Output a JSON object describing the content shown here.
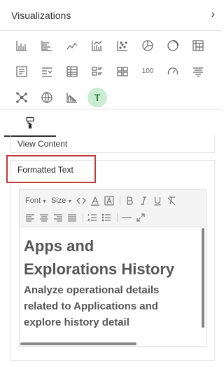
{
  "panel": {
    "title": "Visualizations",
    "collapse_icon": "chevron-right-icon"
  },
  "visualizations": {
    "rows": [
      [
        {
          "name": "column-chart-icon"
        },
        {
          "name": "bar-chart-icon"
        },
        {
          "name": "line-chart-icon"
        },
        {
          "name": "combo-chart-icon"
        },
        {
          "name": "scatter-chart-icon"
        },
        {
          "name": "pie-chart-icon"
        },
        {
          "name": "donut-chart-icon"
        },
        {
          "name": "pivot-table-icon"
        }
      ],
      [
        {
          "name": "form-icon"
        },
        {
          "name": "filter-list-icon"
        },
        {
          "name": "table-icon"
        },
        {
          "name": "list-detail-icon"
        },
        {
          "name": "tiles-icon"
        },
        {
          "name": "kpi-number-icon",
          "label": "100"
        },
        {
          "name": "gauge-icon"
        },
        {
          "name": "funnel-icon"
        }
      ],
      [
        {
          "name": "network-icon"
        },
        {
          "name": "map-icon"
        },
        {
          "name": "histogram-icon"
        },
        {
          "name": "formatted-text-icon",
          "label": "T",
          "selected": true
        }
      ]
    ],
    "accent_color": "#c9ecd2"
  },
  "tabs": {
    "active": "format-paintbrush-icon"
  },
  "view_content": {
    "label": "View Content"
  },
  "formatted_text": {
    "title": "Formatted Text",
    "highlight_color": "#c0393b",
    "toolbar": {
      "font_label": "Font",
      "size_label": "Size",
      "buttons_row1": [
        "source-code-icon",
        "text-color-icon",
        "background-color-icon",
        "bold-icon",
        "italic-icon",
        "underline-icon",
        "remove-format-icon"
      ],
      "buttons_row2": [
        "align-left-icon",
        "align-center-icon",
        "align-right-icon",
        "align-justify-icon",
        "numbered-list-icon",
        "bulleted-list-icon",
        "horizontal-rule-icon",
        "maximize-icon"
      ]
    },
    "content": {
      "heading_line1": "Apps and",
      "heading_line2": "Explorations History",
      "body_line1": "Analyze operational details",
      "body_line2": "related to Applications and",
      "body_line3": "explore history detail"
    }
  }
}
